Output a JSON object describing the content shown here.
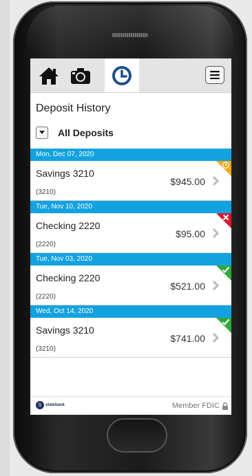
{
  "screen": {
    "title": "Deposit History",
    "filter_label": "All Deposits"
  },
  "icons": {
    "home": "home-icon",
    "camera": "camera-icon",
    "history": "clock-icon",
    "menu": "hamburger-menu-icon",
    "dropdown": "chevron-down-icon",
    "row_chevron": "chevron-right-icon",
    "pending": "clock-icon",
    "rejected": "x-icon",
    "accepted": "check-icon",
    "lock": "lock-icon"
  },
  "colors": {
    "date_bar": "#13a2e0",
    "pending": "#f3a712",
    "rejected": "#e0142b",
    "accepted": "#2eaa3a",
    "active_tab_icon": "#1f4f8a"
  },
  "deposits": [
    {
      "date": "Mon, Dec 07, 2020",
      "account": "Savings 3210",
      "number": "(3210)",
      "amount": "$945.00",
      "status": "pending"
    },
    {
      "date": "Tue, Nov 10, 2020",
      "account": "Checking 2220",
      "number": "(2220)",
      "amount": "$95.00",
      "status": "rejected"
    },
    {
      "date": "Tue, Nov 03, 2020",
      "account": "Checking 2220",
      "number": "(2220)",
      "amount": "$521.00",
      "status": "accepted"
    },
    {
      "date": "Wed, Oct 14, 2020",
      "account": "Savings 3210",
      "number": "(3210)",
      "amount": "$741.00",
      "status": "accepted"
    }
  ],
  "footer": {
    "logo_mark": "S",
    "logo_text": "statebank",
    "fdic": "Member FDIC"
  }
}
